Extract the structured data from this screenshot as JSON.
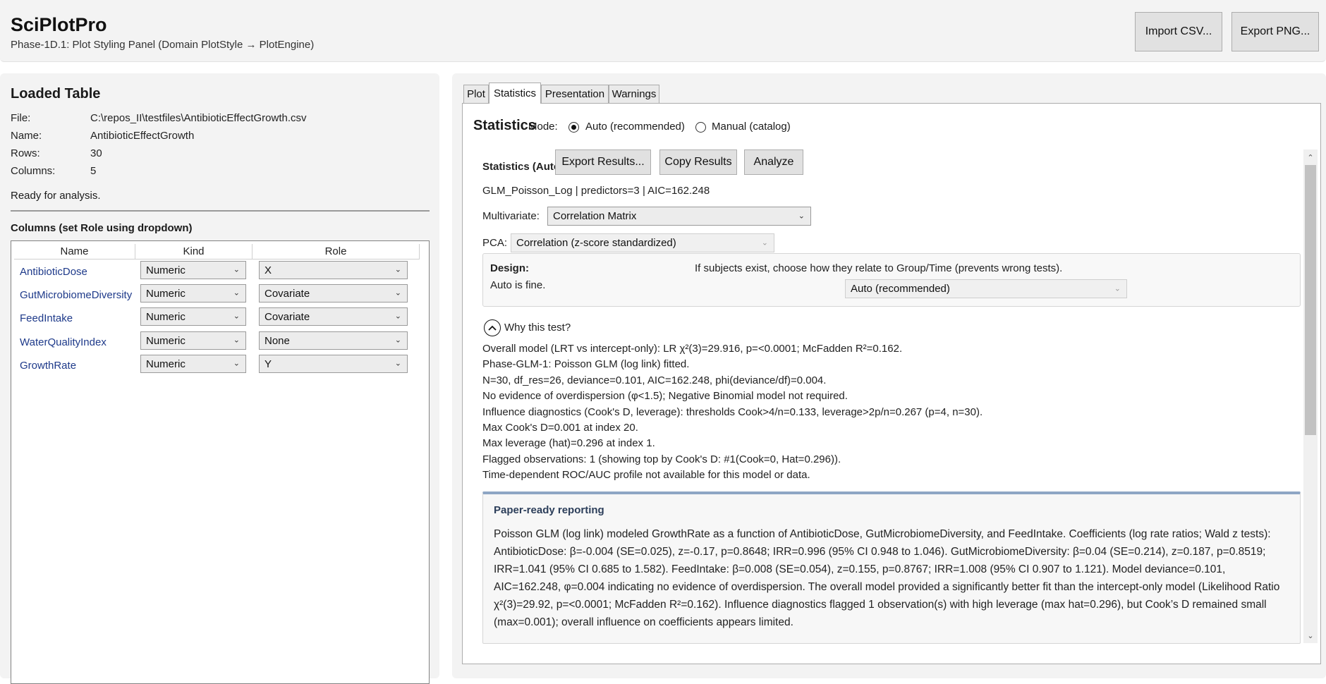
{
  "app": {
    "title": "SciPlotPro",
    "subtitle": "Phase-1D.1: Plot Styling Panel (Domain PlotStyle → PlotEngine)"
  },
  "toolbar": {
    "import_label": "Import CSV...",
    "export_label": "Export PNG..."
  },
  "loaded_table": {
    "title": "Loaded Table",
    "fields": [
      {
        "label": "File:",
        "value": "C:\\repos_II\\testfiles\\AntibioticEffectGrowth.csv"
      },
      {
        "label": "Name:",
        "value": "AntibioticEffectGrowth"
      },
      {
        "label": "Rows:",
        "value": "30"
      },
      {
        "label": "Columns:",
        "value": "5"
      }
    ],
    "status": "Ready for analysis."
  },
  "columns": {
    "title": "Columns (set Role using dropdown)",
    "headers": [
      "Name",
      "Kind",
      "Role"
    ],
    "rows": [
      {
        "name": "AntibioticDose",
        "kind": "Numeric",
        "role": "X"
      },
      {
        "name": "GutMicrobiomeDiversity",
        "kind": "Numeric",
        "role": "Covariate"
      },
      {
        "name": "FeedIntake",
        "kind": "Numeric",
        "role": "Covariate"
      },
      {
        "name": "WaterQualityIndex",
        "kind": "Numeric",
        "role": "None"
      },
      {
        "name": "GrowthRate",
        "kind": "Numeric",
        "role": "Y"
      }
    ]
  },
  "tabs": [
    "Plot",
    "Statistics",
    "Presentation",
    "Warnings"
  ],
  "active_tab": "Statistics",
  "statistics": {
    "title": "Statistics",
    "mode_label": "Mode:",
    "mode_options": [
      "Auto (recommended)",
      "Manual (catalog)"
    ],
    "mode_selected": "Auto (recommended)",
    "auto_header": "Statistics (Auto)",
    "buttons": {
      "export": "Export Results...",
      "copy": "Copy Results",
      "analyze": "Analyze"
    },
    "model_summary": "GLM_Poisson_Log | predictors=3 | AIC=162.248",
    "multivariate_label": "Multivariate:",
    "multivariate_value": "Correlation Matrix",
    "pca_label": "PCA:",
    "pca_value": "Correlation (z-score standardized)",
    "design": {
      "title": "Design:",
      "note": "Auto is fine.",
      "hint": "If subjects exist, choose how they relate to Group/Time (prevents wrong tests).",
      "value": "Auto (recommended)"
    },
    "why_label": "Why this test?",
    "why_lines": [
      "Overall model (LRT vs intercept-only): LR χ²(3)=29.916, p=<0.0001; McFadden R²=0.162.",
      "Phase-GLM-1: Poisson GLM (log link) fitted.",
      "N=30, df_res=26, deviance=0.101, AIC=162.248, phi(deviance/df)=0.004.",
      "No evidence of overdispersion (φ<1.5); Negative Binomial model not required.",
      "Influence diagnostics (Cook's D, leverage): thresholds Cook>4/n=0.133, leverage>2p/n=0.267 (p=4, n=30).",
      "Max Cook's D=0.001 at index 20.",
      "Max leverage (hat)=0.296 at index 1.",
      "Flagged observations: 1 (showing top by Cook's D: #1(Cook=0, Hat=0.296)).",
      "Time-dependent ROC/AUC profile not available for this model or data."
    ],
    "paper": {
      "title": "Paper-ready reporting",
      "text": "Poisson GLM (log link) modeled GrowthRate as a function of AntibioticDose, GutMicrobiomeDiversity, and FeedIntake. Coefficients (log rate ratios; Wald z tests): AntibioticDose: β=-0.004 (SE=0.025), z=-0.17, p=0.8648; IRR=0.996 (95% CI 0.948 to 1.046). GutMicrobiomeDiversity: β=0.04 (SE=0.214), z=0.187, p=0.8519; IRR=1.041 (95% CI 0.685 to 1.582). FeedIntake: β=0.008 (SE=0.054), z=0.155, p=0.8767; IRR=1.008 (95% CI 0.907 to 1.121). Model deviance=0.101, AIC=162.248, φ=0.004 indicating no evidence of overdispersion. The overall model provided a significantly better fit than the intercept-only model (Likelihood Ratio χ²(3)=29.92, p=<0.0001; McFadden R²=0.162). Influence diagnostics flagged 1 observation(s) with high leverage (max hat=0.296), but Cook’s D remained small (max=0.001); overall influence on coefficients appears limited."
    }
  },
  "icons": {
    "dropdown": "chevron-down-icon",
    "collapse": "chevron-up-circle-icon",
    "scroll_up": "scroll-up-arrow-icon",
    "scroll_down": "scroll-down-arrow-icon"
  }
}
